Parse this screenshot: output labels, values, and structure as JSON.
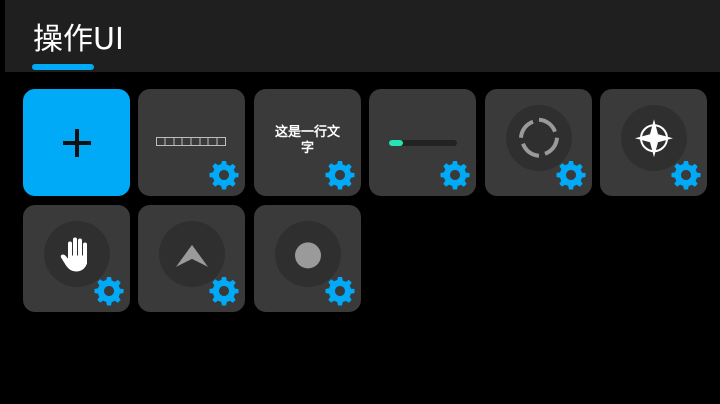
{
  "header": {
    "title": "操作UI"
  },
  "colors": {
    "accent": "#00aaf7",
    "tile": "#3a3a3a",
    "progress": "#27e2b3",
    "header_bg": "#1f1f1f"
  },
  "tiles": [
    {
      "kind": "add",
      "icon": "plus-icon"
    },
    {
      "kind": "bar-segments",
      "icon": "segmented-bar-icon",
      "has_settings": true
    },
    {
      "kind": "text",
      "text": "这是一行文字",
      "has_settings": true
    },
    {
      "kind": "progress",
      "icon": "progress-bar-icon",
      "progress": 0.2,
      "has_settings": true
    },
    {
      "kind": "crosshair",
      "icon": "dashed-ring-icon",
      "has_settings": true
    },
    {
      "kind": "compass",
      "icon": "compass-star-icon",
      "has_settings": true
    },
    {
      "kind": "hand",
      "icon": "hand-icon",
      "has_settings": true
    },
    {
      "kind": "arrow",
      "icon": "arrow-up-icon",
      "has_settings": true
    },
    {
      "kind": "dot",
      "icon": "joystick-dot-icon",
      "has_settings": true
    }
  ]
}
